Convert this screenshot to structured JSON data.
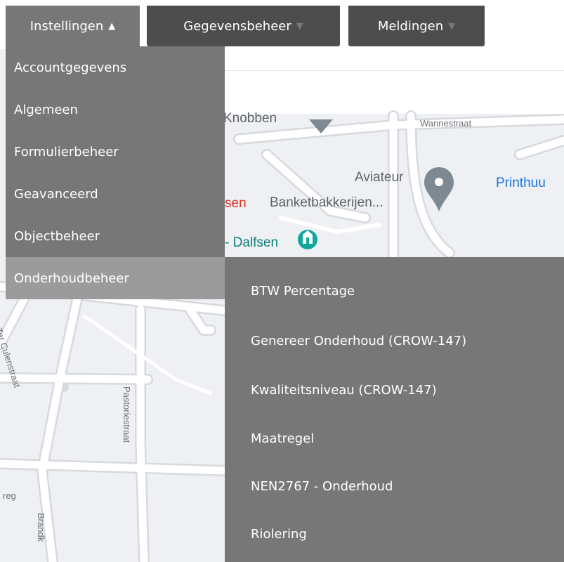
{
  "nav": {
    "items": [
      {
        "label": "Instellingen",
        "arrow": "▲"
      },
      {
        "label": "Gegevensbeheer",
        "arrow": "▼"
      },
      {
        "label": "Meldingen",
        "arrow": "▼"
      }
    ]
  },
  "dropdown": {
    "items": [
      "Accountgegevens",
      "Algemeen",
      "Formulierbeheer",
      "Geavanceerd",
      "Objectbeheer",
      "Onderhoudbeheer"
    ]
  },
  "submenu": {
    "items": [
      "BTW Percentage",
      "Genereer Onderhoud (CROW-147)",
      "Kwaliteitsniveau (CROW-147)",
      "Maatregel",
      "NEN2767 - Onderhoud",
      "Riolering"
    ]
  },
  "map": {
    "labels": {
      "knobben": "Knobben",
      "wannestraat": "Wannestraat",
      "aviateur": "Aviateur",
      "banketbakkerijen": "Banketbakkerijen...",
      "printhuu": "Printhuu",
      "sen": "sen",
      "dalfsen": "- Dalfsen",
      "ter_culenstraat": "Ter Culenstraat",
      "pastoriestraat": "Pastoriestraat",
      "eg": "reg",
      "brandk": "Brandk"
    },
    "colors": {
      "background": "#eef0f3",
      "road": "#ffffff",
      "road_edge": "#d6d9dd",
      "pin_grey": "#7d8a91",
      "pin_teal": "#11a79c",
      "poi_red": "#d93025",
      "poi_blue": "#1a73e8"
    }
  },
  "colors": {
    "menu_bg": "#777777",
    "menu_highlight": "#9b9b9b",
    "nav_dark": "#4d4d4d",
    "text": "#ffffff"
  }
}
